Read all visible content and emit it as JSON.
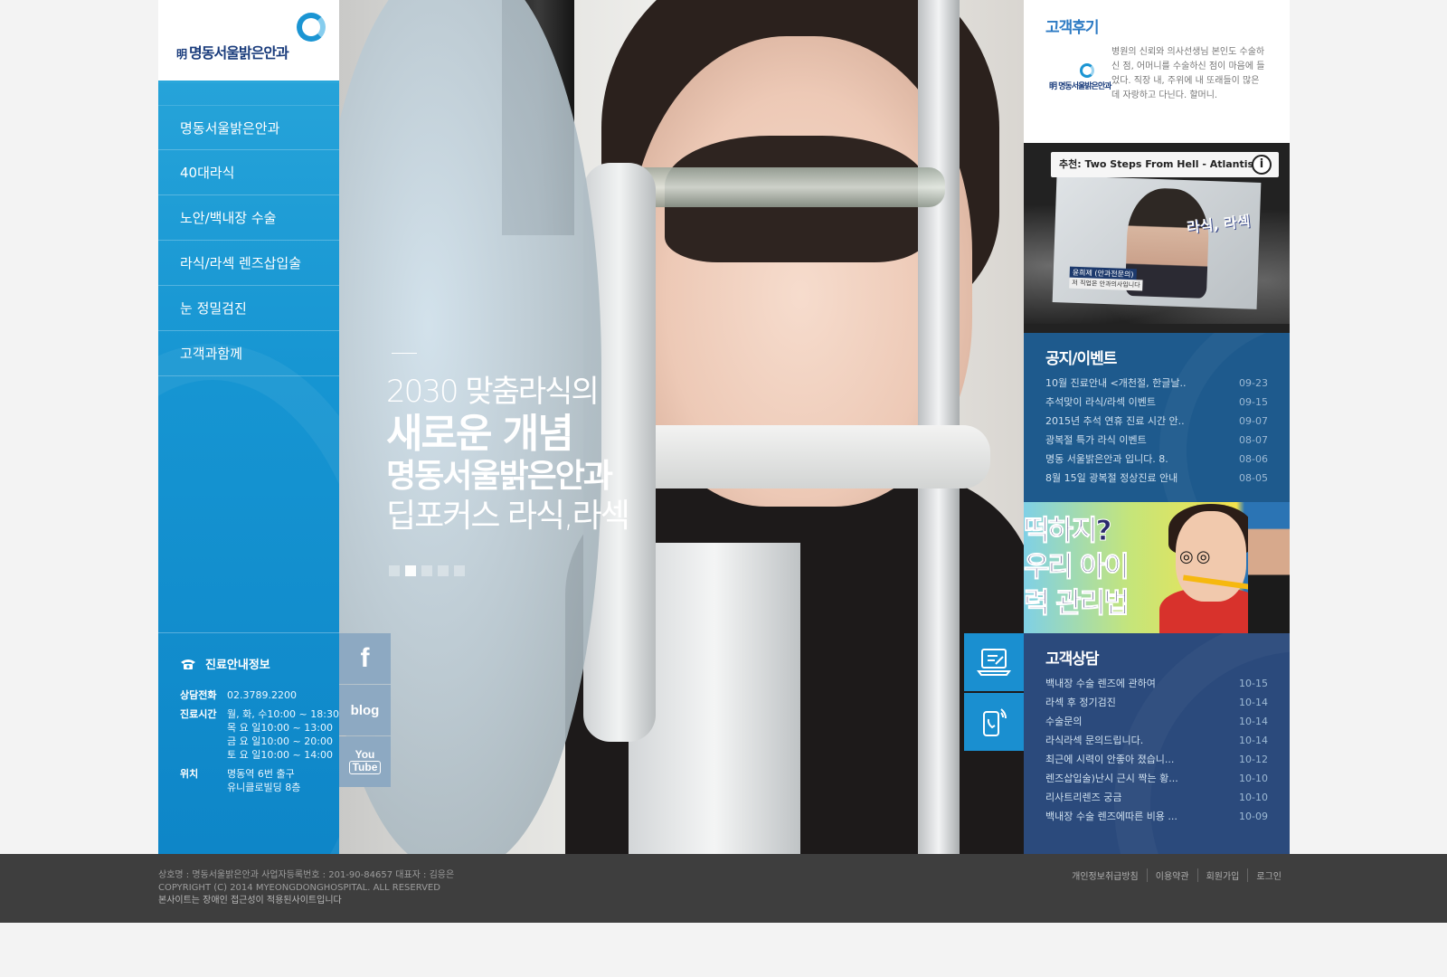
{
  "brand": {
    "name": "명동서울밝은안과",
    "mark": "明"
  },
  "menu": [
    {
      "label": "명동서울밝은안과"
    },
    {
      "label": "40대라식"
    },
    {
      "label": "노안/백내장 수술"
    },
    {
      "label": "라식/라섹 렌즈삽입술"
    },
    {
      "label": "눈 정밀검진"
    },
    {
      "label": "고객과함께"
    }
  ],
  "info": {
    "title": "진료안내정보",
    "phone_label": "상담전화",
    "phone": "02.3789.2200",
    "hours_label": "진료시간",
    "hours": [
      "월, 화, 수10:00 ~ 18:30",
      "목  요  일10:00 ~ 13:00",
      "금  요  일10:00 ~ 20:00",
      "토  요  일10:00 ~ 14:00"
    ],
    "location_label": "위치",
    "location": [
      "명동역 6번 출구",
      "유니클로빌딩 8층"
    ]
  },
  "hero": {
    "line1": "2030 맞춤라식의",
    "line2": "새로운 개념",
    "line3": "명동서울밝은안과",
    "line4": "딥포커스 라식,라섹",
    "dots_count": 5,
    "active_dot": 2
  },
  "social": {
    "facebook": "f",
    "blog": "blog",
    "youtube_top": "You",
    "youtube_bottom": "Tube"
  },
  "review": {
    "title": "고객후기",
    "logo_text": "明 명동서울밝은안과",
    "body": "병원의 신뢰와 의사선생님 본인도 수술하신 점, 어머니를 수술하신 점이 마음에 들었다. 직장 내, 주위에 내 또래들이 많은데 자랑하고 다닌다. 할머니."
  },
  "video": {
    "title": "추천: Two Steps From Hell - Atlantis ...",
    "info_icon": "i",
    "overlay": "라식, 라섹",
    "caption": "윤희제 (안과전문의)",
    "caption2": "저 직업은 안과의사입니다"
  },
  "notice": {
    "title": "공지/이벤트",
    "items": [
      {
        "title": "10월 진료안내 <개천절, 한글날..",
        "date": "09-23"
      },
      {
        "title": "추석맞이 라식/라섹 이벤트",
        "date": "09-15"
      },
      {
        "title": "2015년 추석 연휴 진료 시간 안..",
        "date": "09-07"
      },
      {
        "title": "광복절 특가 라식 이벤트",
        "date": "08-07"
      },
      {
        "title": "명동 서울밝은안과 입니다. 8.",
        "date": "08-06"
      },
      {
        "title": "8월 15일 광복절 정상진료 안내",
        "date": "08-05"
      }
    ]
  },
  "banner": {
    "line1": "떡하지?",
    "line2": "우리 아이",
    "line3": "력 관리법",
    "glasses": "◎◎"
  },
  "consult": {
    "title": "고객상담",
    "items": [
      {
        "title": "백내장 수술 렌즈에 관하여",
        "date": "10-15"
      },
      {
        "title": "라섹 후 정기검진",
        "date": "10-14"
      },
      {
        "title": "수술문의",
        "date": "10-14"
      },
      {
        "title": "라식라섹 문의드립니다.",
        "date": "10-14"
      },
      {
        "title": "최근에 시력이 안좋아 졌습니...",
        "date": "10-12"
      },
      {
        "title": "렌즈삽입술)난시 근시 짝는 황...",
        "date": "10-10"
      },
      {
        "title": "리사트리렌즈 궁금",
        "date": "10-10"
      },
      {
        "title": "백내장 수술 렌즈에따른 비용 ...",
        "date": "10-09"
      }
    ]
  },
  "footer": {
    "line1": "상호명 : 명동서울밝은안과    사업자등록번호 : 201-90-84657  대표자 : 김응은",
    "line2": "COPYRIGHT (C) 2014 MYEONGDONGHOSPITAL. ALL RESERVED",
    "line3": "본사이트는 장애인 접근성이 적용된사이트입니다",
    "links": [
      "개인정보취급방침",
      "이용약관",
      "회원가입",
      "로그인"
    ]
  }
}
